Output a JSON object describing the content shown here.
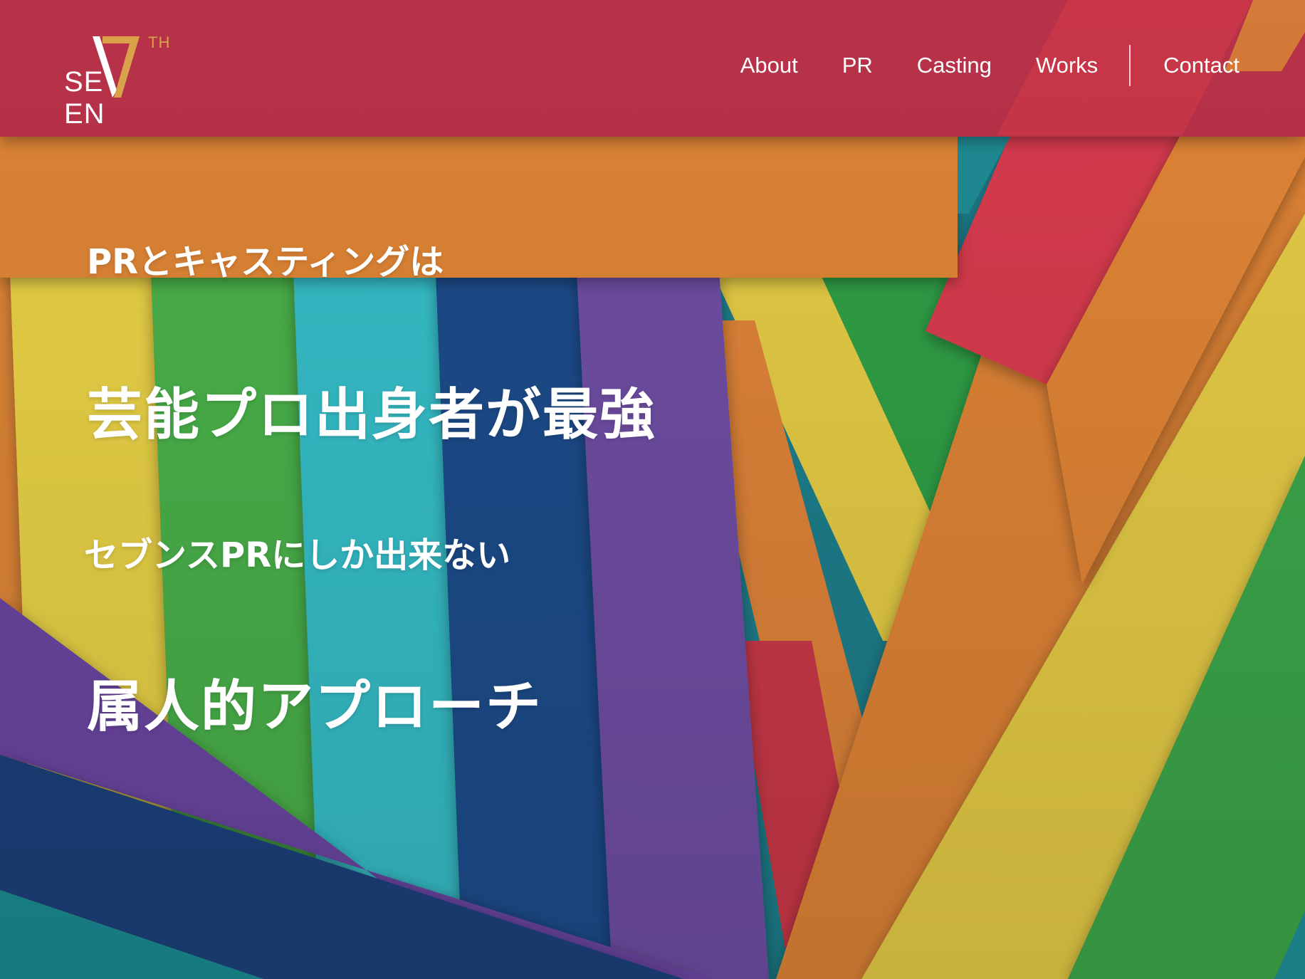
{
  "logo": {
    "superscript": "TH",
    "prefix": "SE",
    "suffix": "EN",
    "accent_color": "#d9a24a"
  },
  "nav": {
    "items": [
      {
        "label": "About"
      },
      {
        "label": "PR"
      },
      {
        "label": "Casting"
      },
      {
        "label": "Works"
      },
      {
        "label": "Contact"
      }
    ]
  },
  "hero": {
    "line1": "PRとキャスティングは",
    "line2": "芸能プロ出身者が最強",
    "line3": "セブンスPRにしか出来ない",
    "line4": "属人的アプローチ"
  },
  "colors": {
    "red": "#c0344a",
    "orange": "#dd8236",
    "yellow": "#e4cc42",
    "green": "#44ae48",
    "teal": "#33b8c4",
    "navy": "#1f4c8a",
    "purple": "#6f4da0"
  }
}
